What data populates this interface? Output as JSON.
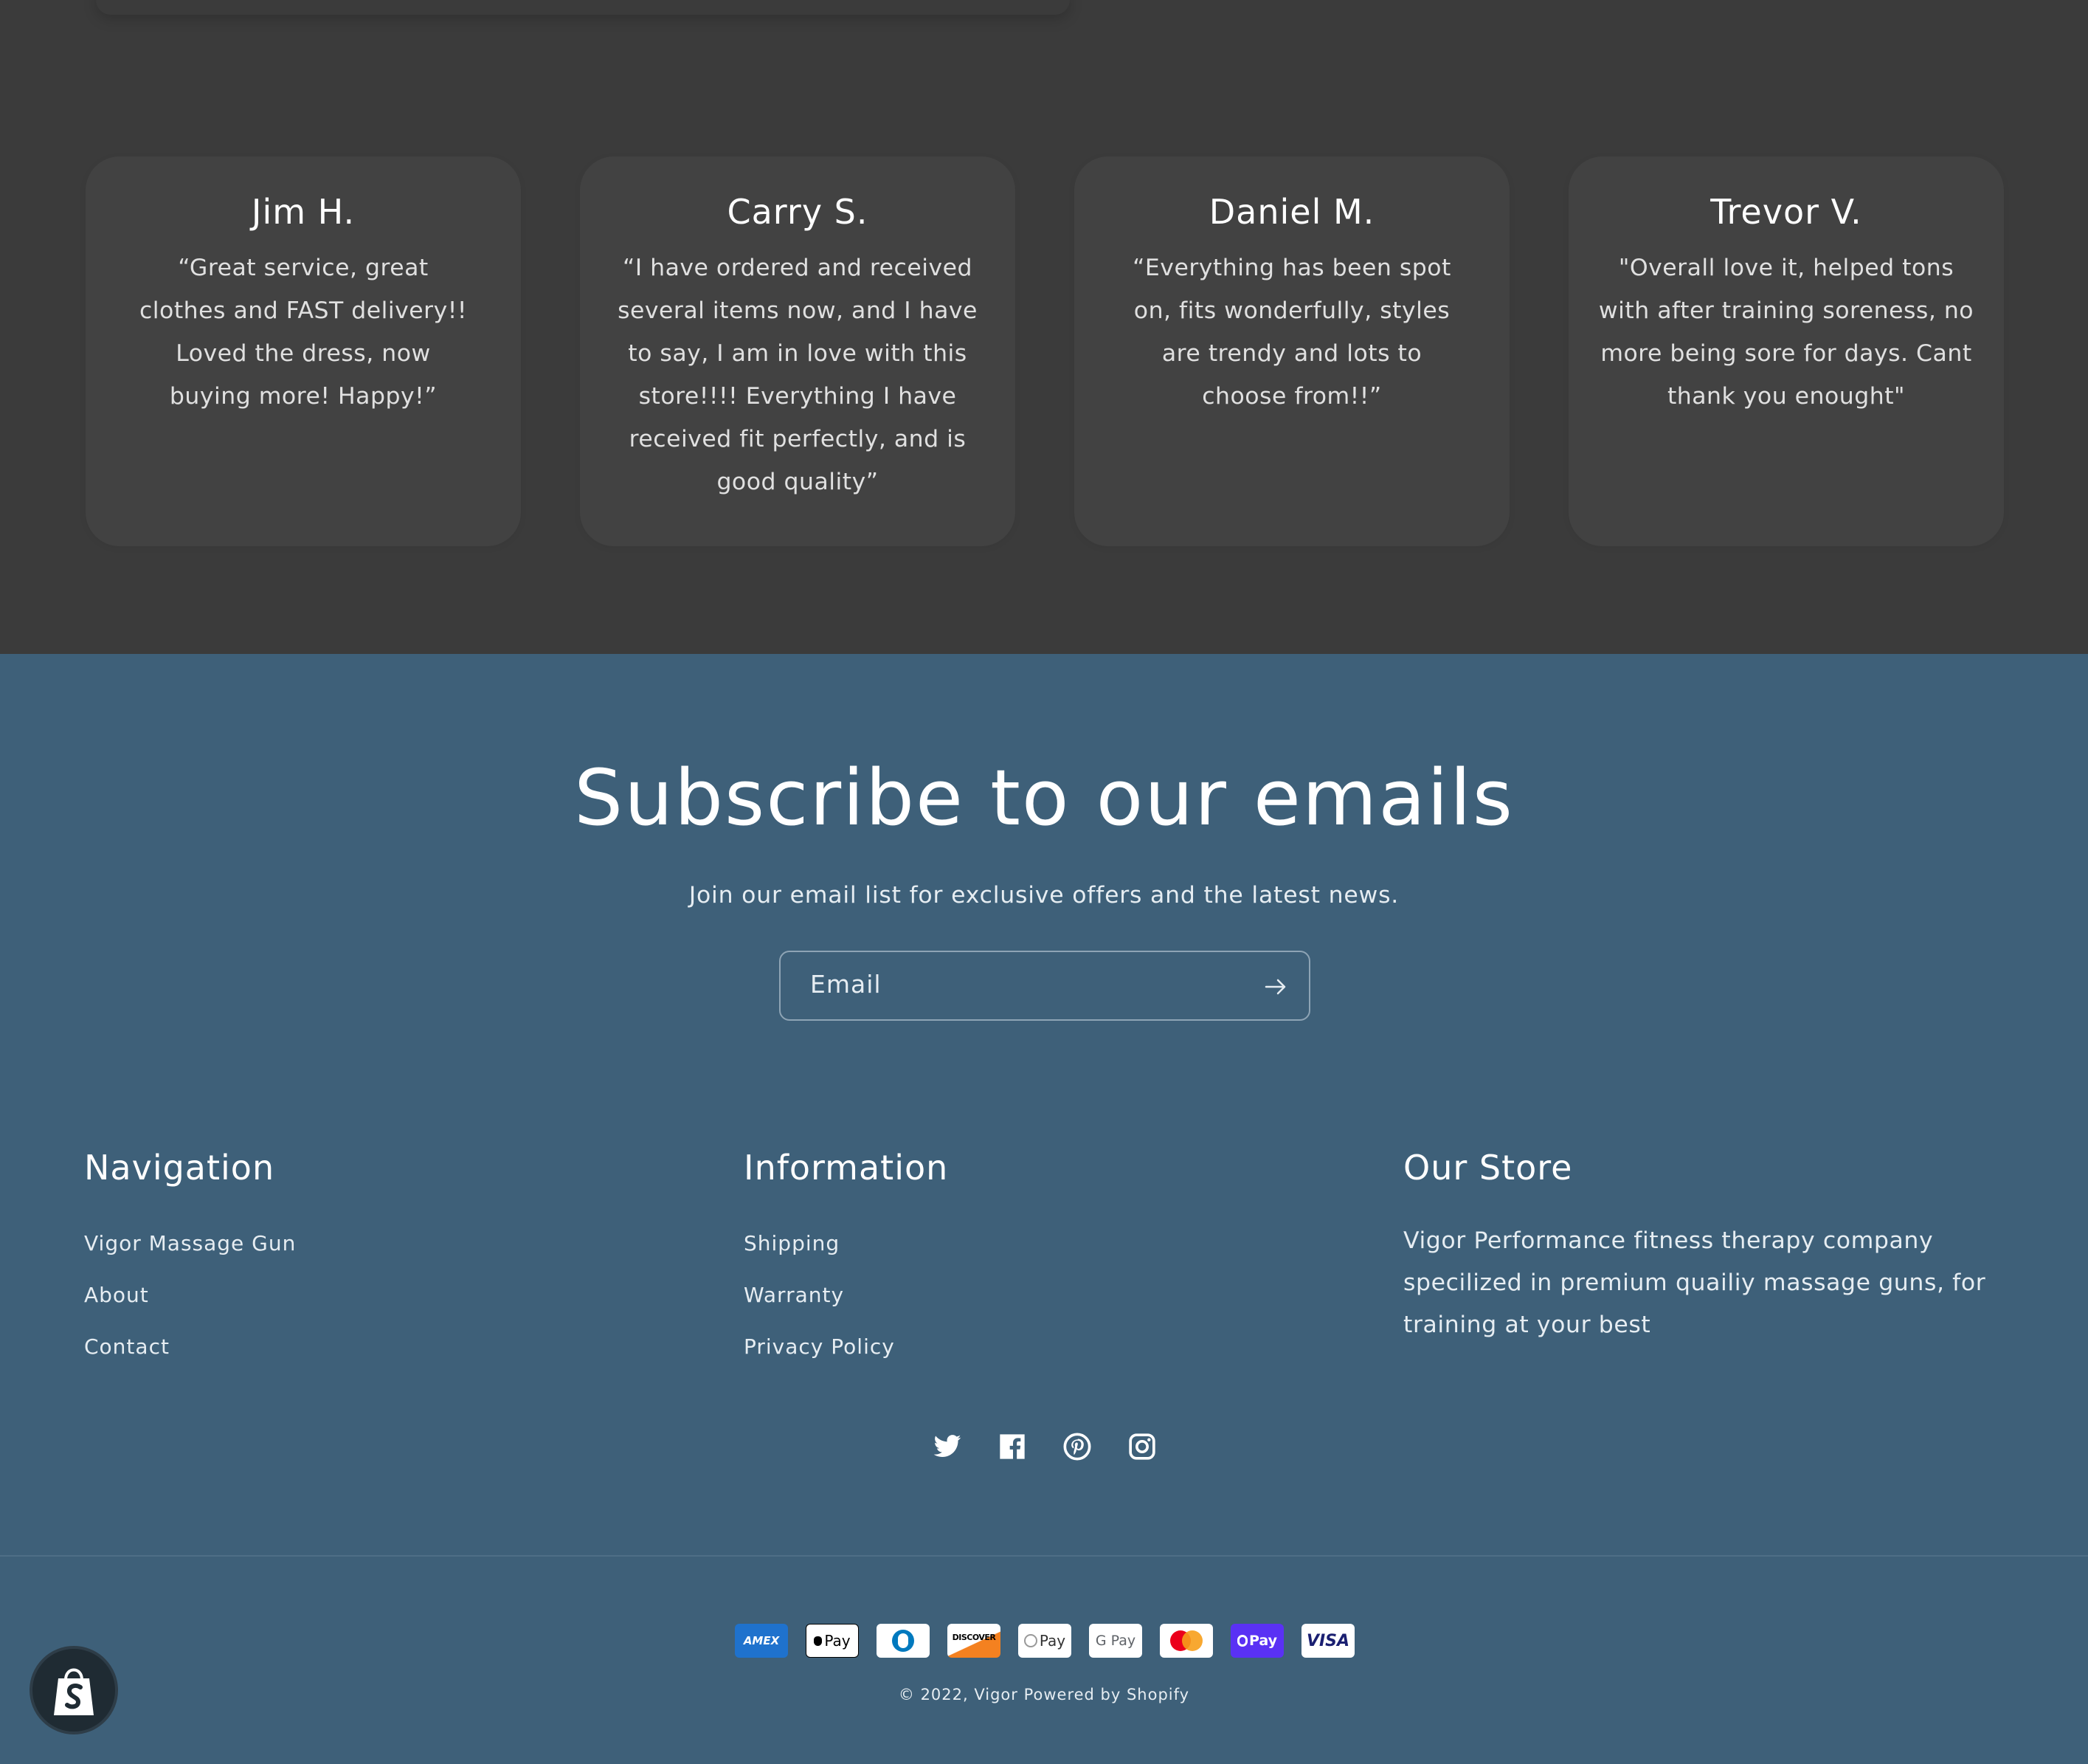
{
  "testimonials": [
    {
      "name": "Jim H.",
      "quote": "“Great service, great clothes and FAST delivery!! Loved the dress, now buying more! Happy!”"
    },
    {
      "name": "Carry S.",
      "quote": "“I have ordered and received several items now, and I have to say, I am in love with this store!!!! Everything I have received fit perfectly, and is good quality”"
    },
    {
      "name": "Daniel M.",
      "quote": "“Everything has been spot on, fits wonderfully, styles are trendy and lots to choose from!!”"
    },
    {
      "name": "Trevor V.",
      "quote": "\"Overall love it, helped tons with after training soreness, no more being sore for days. Cant thank you enought\""
    }
  ],
  "subscribe": {
    "title": "Subscribe to our emails",
    "subtitle": "Join our email list for exclusive offers and the latest news.",
    "placeholder": "Email"
  },
  "footer": {
    "navigation": {
      "title": "Navigation",
      "links": [
        "Vigor Massage Gun",
        "About",
        "Contact"
      ]
    },
    "information": {
      "title": "Information",
      "links": [
        "Shipping",
        "Warranty",
        "Privacy Policy"
      ]
    },
    "store": {
      "title": "Our Store",
      "text": "Vigor Performance fitness therapy company specilized in premium quailiy massage guns, for training at your best"
    },
    "social": [
      "twitter-icon",
      "facebook-icon",
      "pinterest-icon",
      "instagram-icon"
    ],
    "payments": [
      {
        "label": "AMEX",
        "color": "#1f72cd"
      },
      {
        "label": "Pay",
        "color": "#000000"
      },
      {
        "label": "",
        "color": "#0079be"
      },
      {
        "label": "DISCOVER",
        "color": "#000000"
      },
      {
        "label": "Pay",
        "color": "#333333"
      },
      {
        "label": "G Pay",
        "color": "#5f6368"
      },
      {
        "label": "",
        "color": "#eb001b"
      },
      {
        "label": "Pay",
        "color": "#ffffff"
      },
      {
        "label": "VISA",
        "color": "#1a1f71"
      }
    ],
    "copyright": "© 2022, Vigor Powered by Shopify"
  },
  "colors": {
    "testimonial_bg": "#3b3b3b",
    "card_bg": "#424242",
    "footer_bg": "#3e6079"
  }
}
